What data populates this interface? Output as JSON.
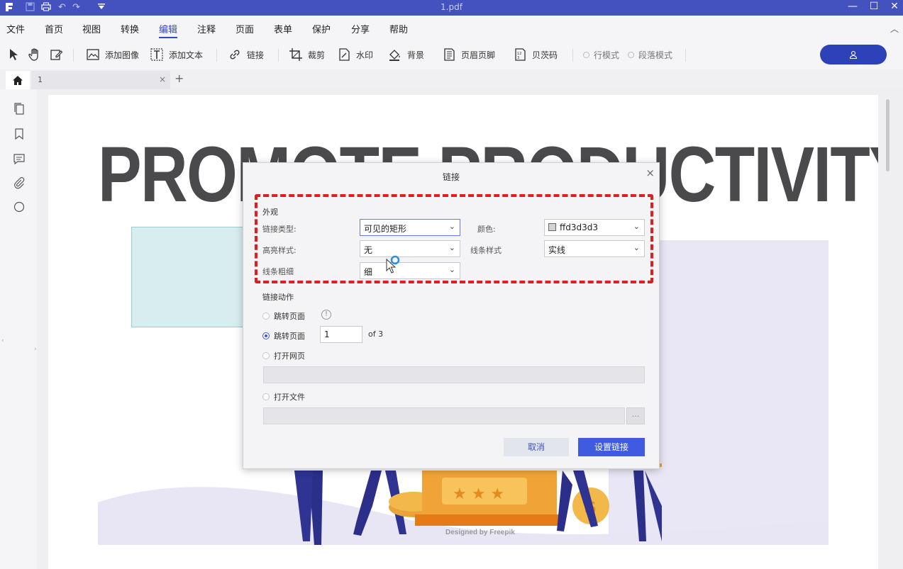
{
  "window": {
    "title": "1.pdf",
    "controls": [
      "minimize-icon",
      "maximize-icon",
      "close-icon"
    ]
  },
  "menu": {
    "items": [
      "文件",
      "首页",
      "视图",
      "转换",
      "编辑",
      "注释",
      "页面",
      "表单",
      "保护",
      "分享",
      "帮助"
    ],
    "active": "编辑"
  },
  "toolbar": {
    "add_image": "添加图像",
    "add_text": "添加文本",
    "link": "链接",
    "crop": "裁剪",
    "watermark": "水印",
    "background": "背景",
    "header_footer": "页眉页脚",
    "bates": "贝茨码",
    "line_mode": "行模式",
    "paragraph_mode": "段落模式"
  },
  "tabs": {
    "doc_tab": "1",
    "close": "×",
    "add": "+"
  },
  "page": {
    "headline": "PROMOTE PRODUCTIVITY",
    "credit": "Designed by Freepik"
  },
  "dialog": {
    "title": "链接",
    "close": "×",
    "appearance_section": "外观",
    "link_type_label": "链接类型:",
    "link_type_value": "可见的矩形",
    "color_label": "颜色:",
    "color_value": "ffd3d3d3",
    "color_swatch": "#d3d3d3",
    "highlight_label": "高亮样式:",
    "highlight_value": "无",
    "line_style_label": "线条样式",
    "line_style_value": "实线",
    "line_width_label": "线条粗细",
    "line_width_value": "细",
    "action_section": "链接动作",
    "goto_page_label_1": "跳转页面",
    "goto_page_label_2": "跳转页面",
    "page_number": "1",
    "page_total": "of 3",
    "open_web_label": "打开网页",
    "open_file_label": "打开文件",
    "browse": "...",
    "cancel_button": "取消",
    "set_link_button": "设置链接",
    "selected_action": "跳转页面"
  },
  "colors": {
    "titlebar": "#4452bf",
    "accent": "#3f5bdf",
    "highlight_box": "#e11d1d"
  }
}
